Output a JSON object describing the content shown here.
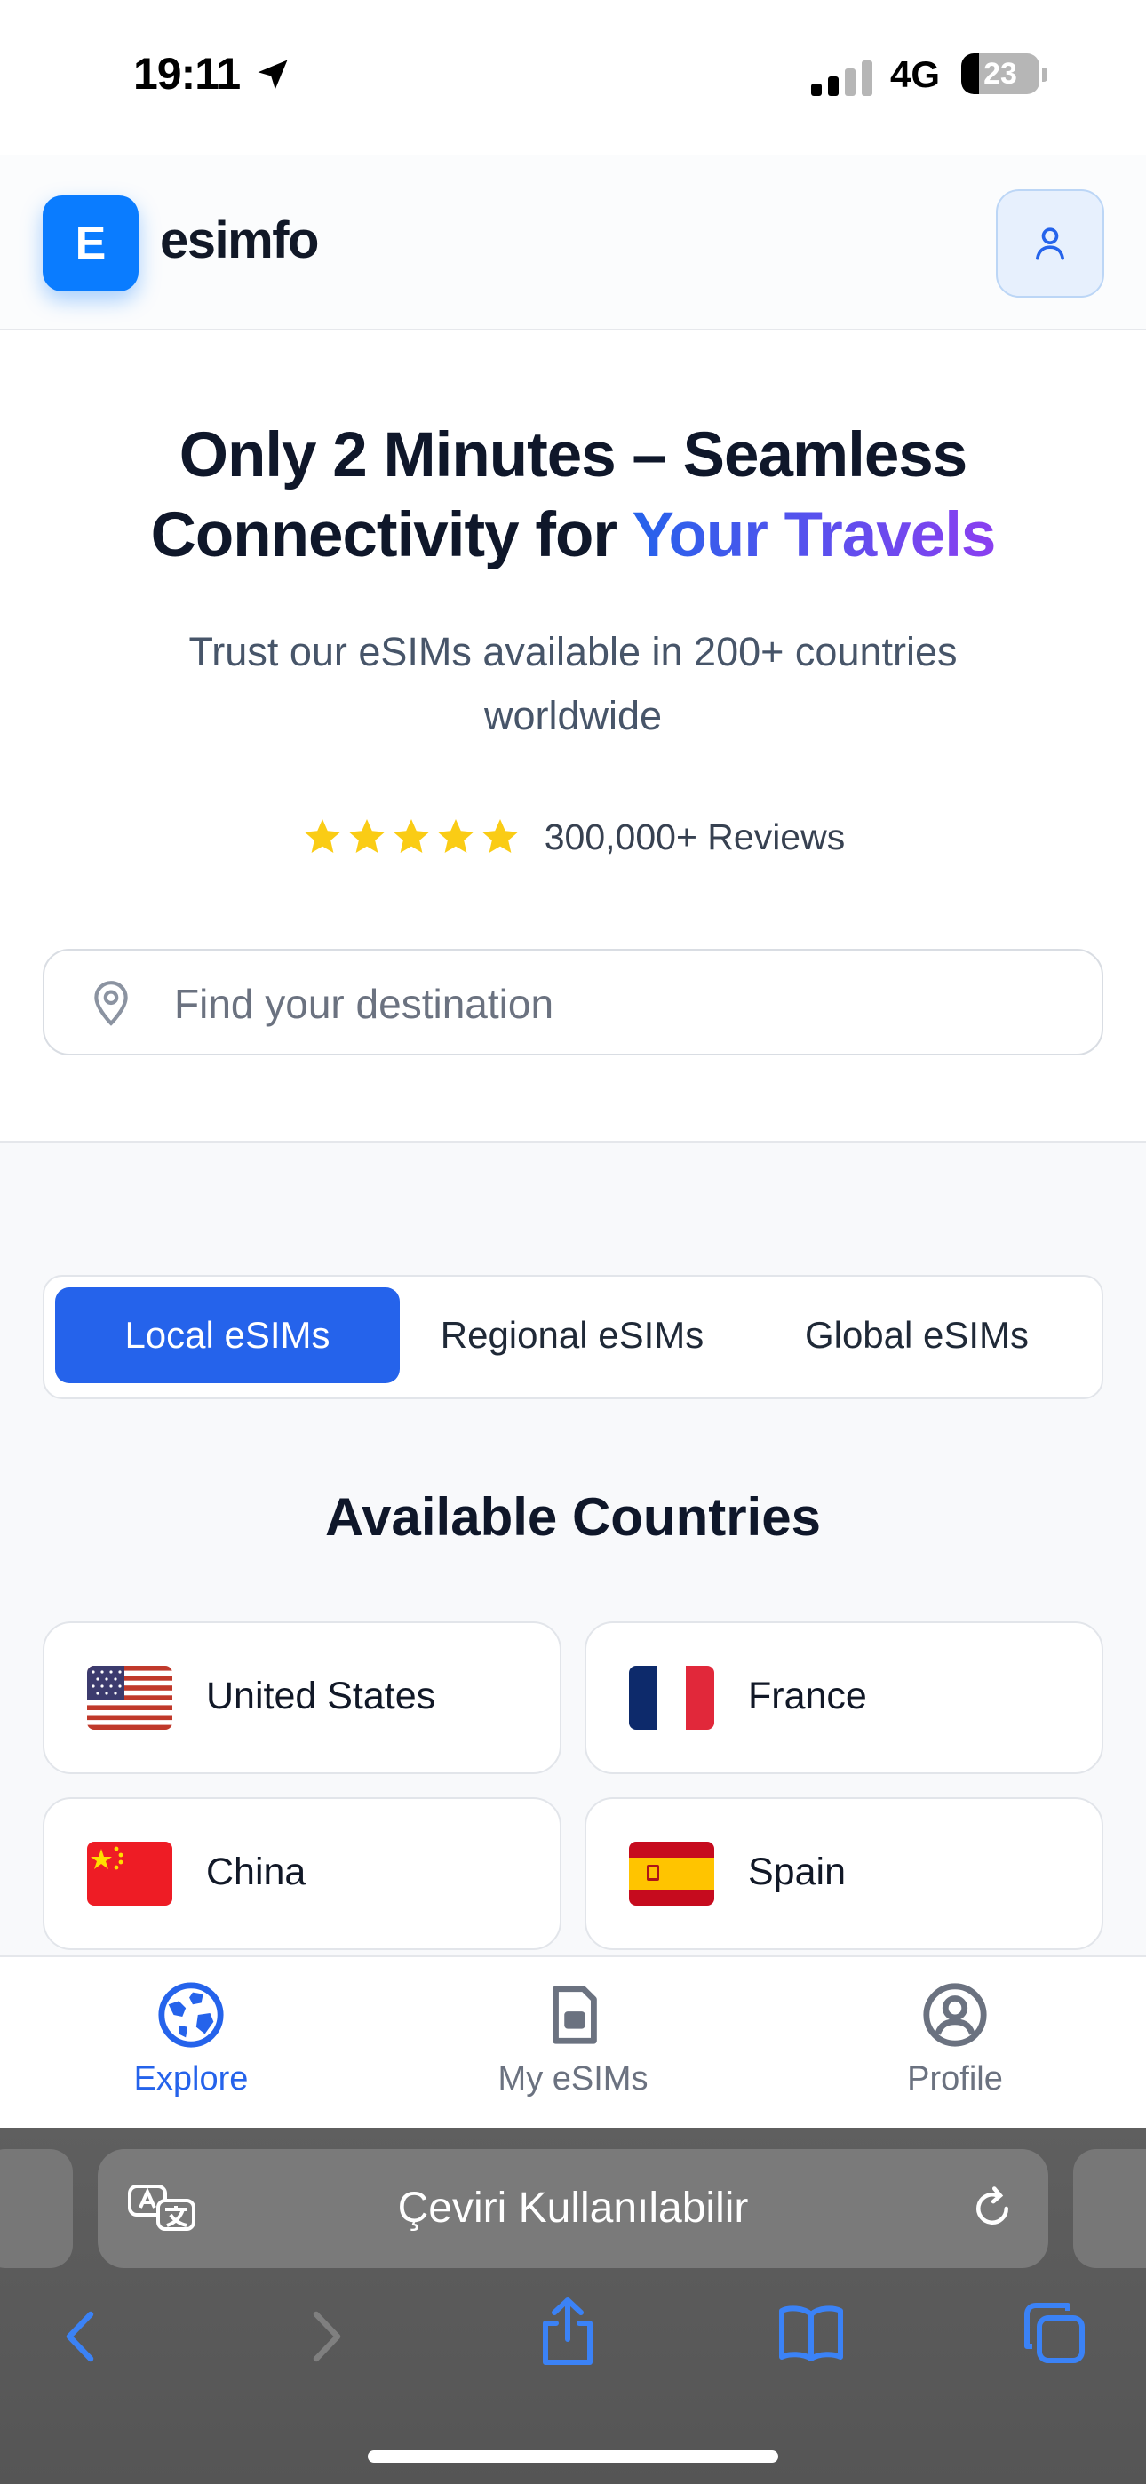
{
  "status_bar": {
    "time": "19:11",
    "network": "4G",
    "battery": "23",
    "battery_level": 0.23
  },
  "header": {
    "logo_letter": "E",
    "brand": "esimfo"
  },
  "hero": {
    "title_line1": "Only 2 Minutes – Seamless",
    "title_line2_plain": "Connectivity for ",
    "title_line2_highlight": "Your Travels",
    "subtitle": "Trust our eSIMs available in 200+ countries worldwide",
    "rating_stars": 5,
    "reviews": "300,000+ Reviews",
    "star_color": "#FACC15"
  },
  "search": {
    "placeholder": "Find your destination"
  },
  "tabs": [
    {
      "label": "Local eSIMs",
      "active": true
    },
    {
      "label": "Regional eSIMs",
      "active": false
    },
    {
      "label": "Global eSIMs",
      "active": false
    }
  ],
  "section_title": "Available Countries",
  "countries": [
    {
      "name": "United States",
      "flag": "us-flag-icon"
    },
    {
      "name": "France",
      "flag": "france-flag-icon"
    },
    {
      "name": "China",
      "flag": "china-flag-icon"
    },
    {
      "name": "Spain",
      "flag": "spain-flag-icon"
    }
  ],
  "bottom_nav": [
    {
      "label": "Explore",
      "icon": "globe-icon",
      "active": true
    },
    {
      "label": "My eSIMs",
      "icon": "sim-card-icon",
      "active": false
    },
    {
      "label": "Profile",
      "icon": "user-circle-icon",
      "active": false
    }
  ],
  "browser": {
    "address_text": "Çeviri Kullanılabilir"
  },
  "colors": {
    "accent": "#2563EB",
    "logo": "#0A7CFF",
    "gradient_end": "#8B3FF0"
  }
}
